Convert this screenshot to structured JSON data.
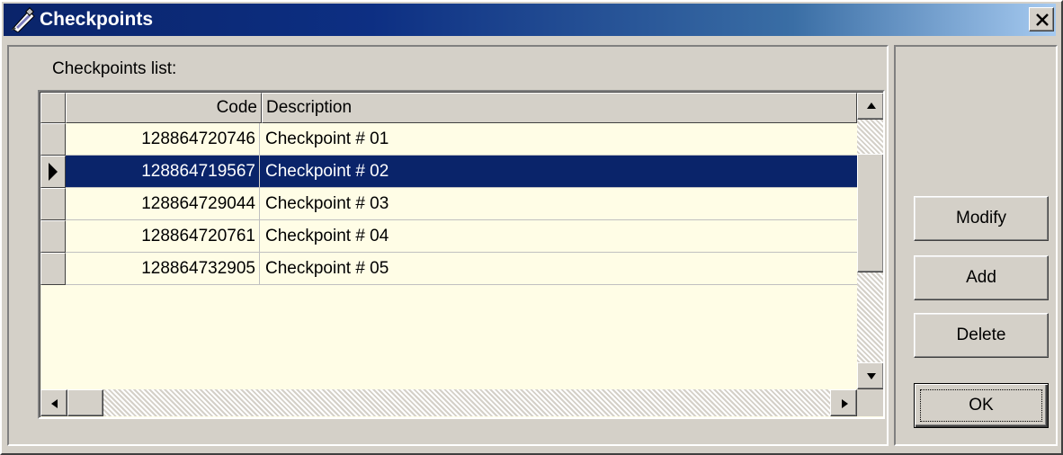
{
  "window": {
    "title": "Checkpoints"
  },
  "list_label": "Checkpoints list:",
  "table": {
    "columns": [
      "Code",
      "Description"
    ],
    "rows": [
      {
        "code": "128864720746",
        "description": "Checkpoint  # 01",
        "selected": false
      },
      {
        "code": "128864719567",
        "description": "Checkpoint  # 02",
        "selected": true
      },
      {
        "code": "128864729044",
        "description": "Checkpoint  # 03",
        "selected": false
      },
      {
        "code": "128864720761",
        "description": "Checkpoint  # 04",
        "selected": false
      },
      {
        "code": "128864732905",
        "description": "Checkpoint  # 05",
        "selected": false
      }
    ]
  },
  "buttons": {
    "modify": "Modify",
    "add": "Add",
    "delete": "Delete",
    "ok": "OK"
  },
  "colors": {
    "title_bar": "#0a246a",
    "selection": "#0a246a",
    "grid_background": "#fffde6",
    "face": "#d4d0c8"
  },
  "icons": [
    "app-icon",
    "close-icon",
    "row-pointer-icon",
    "scroll-up-icon",
    "scroll-down-icon",
    "scroll-left-icon",
    "scroll-right-icon"
  ]
}
